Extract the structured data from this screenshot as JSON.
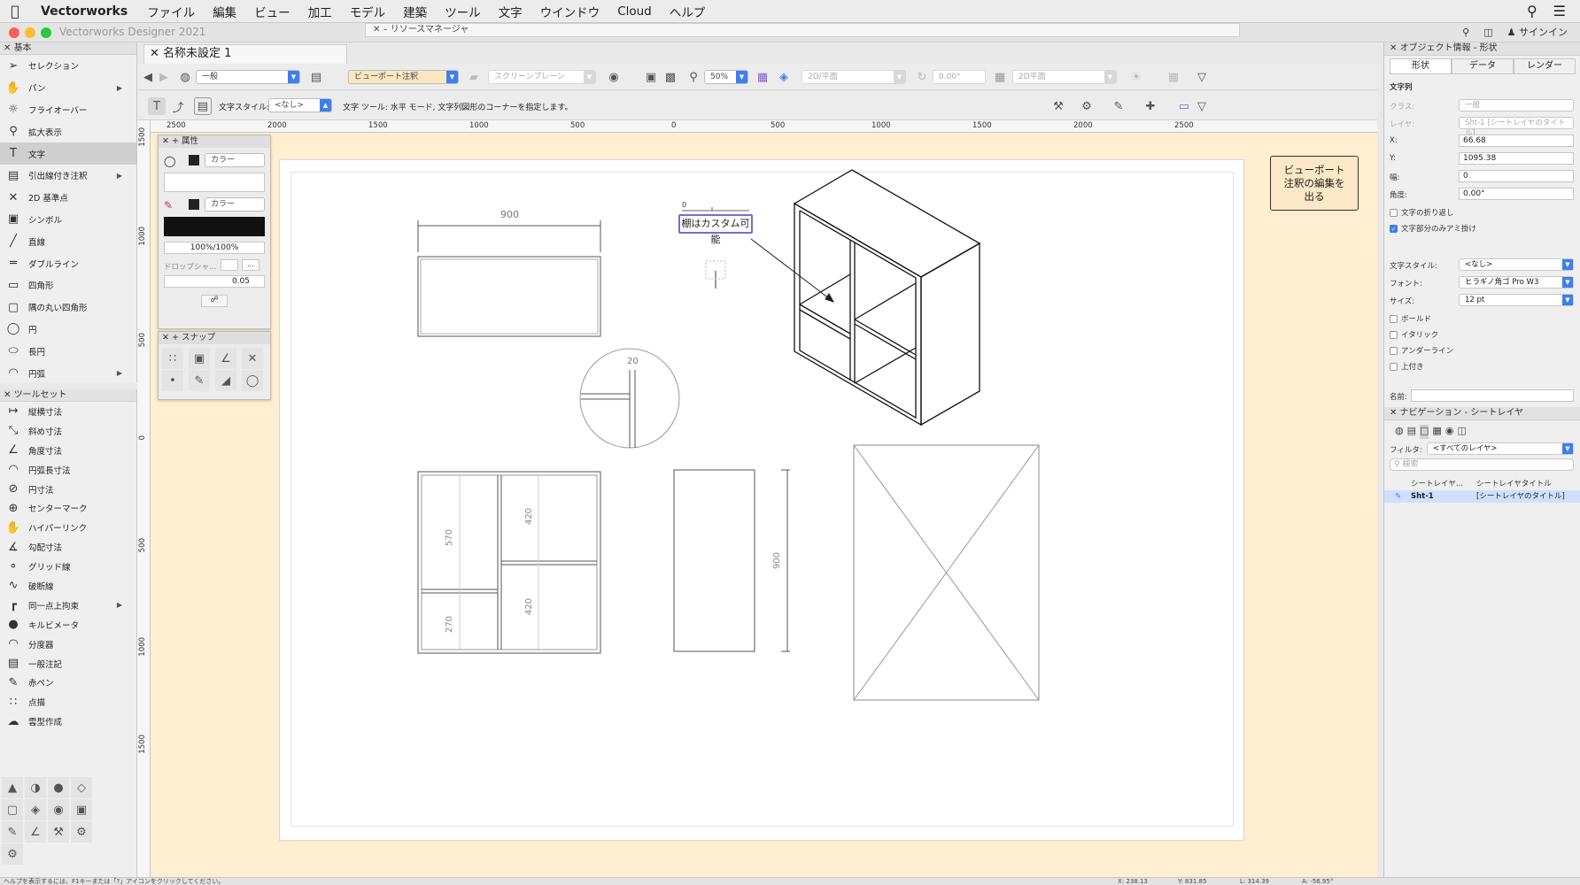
{
  "menubar": {
    "app": "Vectorworks",
    "items": [
      "ファイル",
      "編集",
      "ビュー",
      "加工",
      "モデル",
      "建築",
      "ツール",
      "文字",
      "ウインドウ",
      "Cloud",
      "ヘルプ"
    ]
  },
  "window": {
    "title": "Vectorworks Designer 2021",
    "resource_manager": "リソースマネージャ",
    "signin": "サインイン"
  },
  "doc": {
    "tab": "名称未設定 1"
  },
  "palette_basic": {
    "title": "基本",
    "tools": [
      {
        "label": "セレクション",
        "icon": "arrow-icon"
      },
      {
        "label": "パン",
        "icon": "hand-icon"
      },
      {
        "label": "フライオーバー",
        "icon": "flyover-icon"
      },
      {
        "label": "拡大表示",
        "icon": "zoom-icon"
      },
      {
        "label": "文字",
        "icon": "text-icon"
      },
      {
        "label": "引出線付き注釈",
        "icon": "callout-icon"
      },
      {
        "label": "2D 基準点",
        "icon": "locus-icon"
      },
      {
        "label": "シンボル",
        "icon": "symbol-icon"
      },
      {
        "label": "直線",
        "icon": "line-icon"
      },
      {
        "label": "ダブルライン",
        "icon": "double-line-icon"
      },
      {
        "label": "四角形",
        "icon": "rectangle-icon"
      },
      {
        "label": "隅の丸い四角形",
        "icon": "rounded-rect-icon"
      },
      {
        "label": "円",
        "icon": "circle-icon"
      },
      {
        "label": "長円",
        "icon": "oval-icon"
      },
      {
        "label": "円弧",
        "icon": "arc-icon"
      }
    ]
  },
  "palette_toolset": {
    "title": "ツールセット",
    "tools": [
      {
        "label": "縦横寸法"
      },
      {
        "label": "斜め寸法"
      },
      {
        "label": "角度寸法"
      },
      {
        "label": "円弧長寸法"
      },
      {
        "label": "円寸法"
      },
      {
        "label": "センターマーク"
      },
      {
        "label": "ハイパーリンク"
      },
      {
        "label": "勾配寸法"
      },
      {
        "label": "グリッド線"
      },
      {
        "label": "破断線"
      },
      {
        "label": "同一点上拘束"
      },
      {
        "label": "キルビメータ"
      },
      {
        "label": "分度器"
      },
      {
        "label": "一般注記"
      },
      {
        "label": "赤ペン"
      },
      {
        "label": "点描"
      },
      {
        "label": "雲型作成"
      }
    ]
  },
  "viewbar": {
    "class": "一般",
    "layer": "ビューポート注釈",
    "plane": "スクリーンプレーン",
    "zoom": "50%",
    "view": "2D/平面",
    "angle": "0.00°",
    "render": "2D平面"
  },
  "modebar": {
    "text_style_label": "文字スタイル:",
    "text_style": "<なし>",
    "hint": "文字 ツール: 水平 モード, 文字列図形のコーナーを指定します。"
  },
  "ruler": {
    "h": [
      "2500",
      "2000",
      "1500",
      "1000",
      "500",
      "0",
      "500",
      "1000",
      "1500",
      "2000",
      "2500"
    ],
    "v": [
      "1500",
      "1000",
      "500",
      "0",
      "500",
      "1000",
      "1500"
    ]
  },
  "attributes": {
    "title": "属性",
    "fill": "カラー",
    "pen": "カラー",
    "opacity": "100%/100%",
    "drop_shadow": "ドロップシャ…",
    "line_weight": "0.05"
  },
  "snap": {
    "title": "スナップ"
  },
  "exit_button": "ビューポート\n注釈の編集を\n出る",
  "drawing": {
    "dim_top": "900",
    "dim_detail": "20",
    "dim_570": "570",
    "dim_420a": "420",
    "dim_420b": "420",
    "dim_270": "270",
    "dim_900v": "900",
    "annotation": "棚はカスタム可能",
    "cursor_label": "0"
  },
  "obj_info": {
    "title": "オブジェクト情報 - 形状",
    "tabs": [
      "形状",
      "データ",
      "レンダー"
    ],
    "type": "文字列",
    "class_label": "クラス:",
    "class": "一般",
    "layer_label": "レイヤ:",
    "layer": "Sht-1 [シートレイヤのタイトル]",
    "x_label": "X:",
    "x": "66.68",
    "y_label": "Y:",
    "y": "1095.38",
    "w_label": "幅:",
    "w": "0",
    "angle_label": "角度:",
    "angle": "0.00°",
    "wrap": "文字の折り返し",
    "mask": "文字部分のみアミ掛け",
    "style_label": "文字スタイル:",
    "style": "<なし>",
    "font_label": "フォント:",
    "font": "ヒラギノ角ゴ Pro W3",
    "size_label": "サイズ:",
    "size": "12 pt",
    "bold": "ボールド",
    "italic": "イタリック",
    "underline": "アンダーライン",
    "superscript": "上付き",
    "name_label": "名前:"
  },
  "nav": {
    "title": "ナビゲーション - シートレイヤ",
    "filter_label": "フィルタ:",
    "filter": "<すべてのレイヤ>",
    "search": "検索",
    "col1": "シートレイヤ…",
    "col2": "シートレイヤタイトル",
    "row_name": "Sht-1",
    "row_title": "[シートレイヤのタイトル]"
  },
  "status": {
    "help": "ヘルプを表示するには、F1キーまたは「?」アイコンをクリックしてください。",
    "x": "X: 238.13",
    "y": "Y: 831.85",
    "l": "L: 314.39",
    "a": "A: -56.95°"
  },
  "colors": {
    "accent": "#3d7ef0",
    "canvas": "#ffeed0",
    "exit": "#fbe8c4"
  }
}
